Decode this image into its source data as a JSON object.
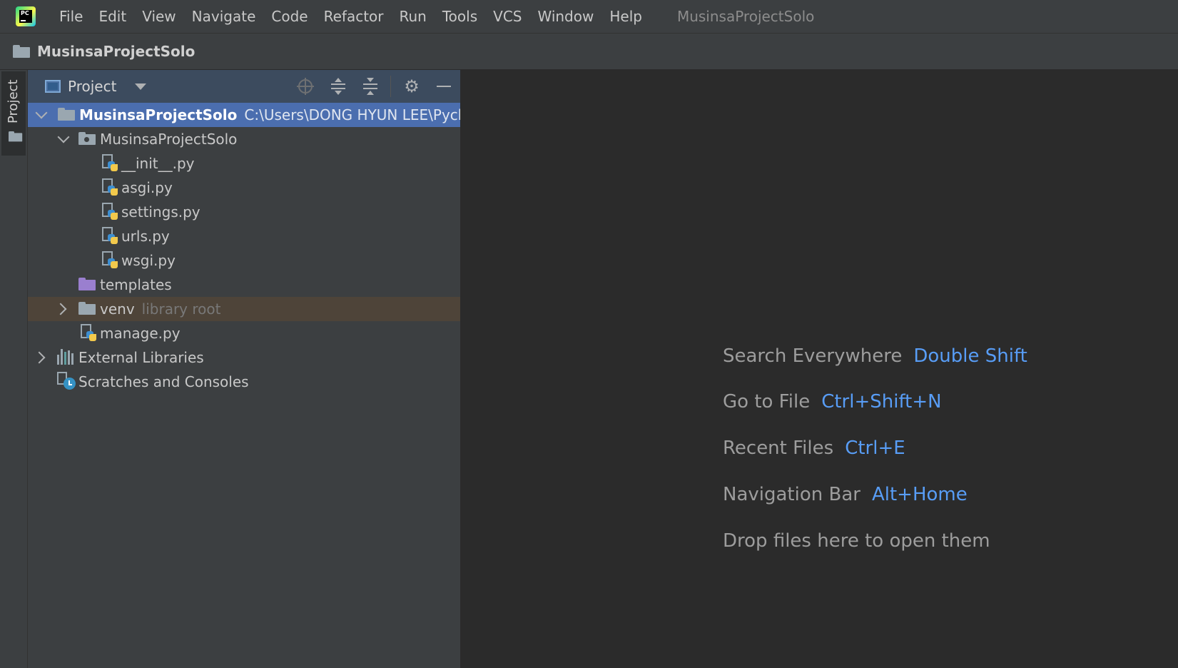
{
  "menubar": {
    "items": [
      "File",
      "Edit",
      "View",
      "Navigate",
      "Code",
      "Refactor",
      "Run",
      "Tools",
      "VCS",
      "Window",
      "Help"
    ],
    "window_title": "MusinsaProjectSolo",
    "logo_text": "PC"
  },
  "navbar": {
    "crumb": "MusinsaProjectSolo"
  },
  "stripe": {
    "project_tab": "Project"
  },
  "project_panel": {
    "title": "Project",
    "tree": {
      "root_name": "MusinsaProjectSolo",
      "root_path": "C:\\Users\\DONG HYUN LEE\\Pych",
      "package_name": "MusinsaProjectSolo",
      "files": [
        "__init__.py",
        "asgi.py",
        "settings.py",
        "urls.py",
        "wsgi.py"
      ],
      "templates": "templates",
      "venv": "venv",
      "venv_hint": "library root",
      "manage": "manage.py",
      "external_libraries": "External Libraries",
      "scratches": "Scratches and Consoles"
    }
  },
  "editor": {
    "hints": [
      {
        "text": "Search Everywhere",
        "key": "Double Shift"
      },
      {
        "text": "Go to File",
        "key": "Ctrl+Shift+N"
      },
      {
        "text": "Recent Files",
        "key": "Ctrl+E"
      },
      {
        "text": "Navigation Bar",
        "key": "Alt+Home"
      }
    ],
    "drop_text": "Drop files here to open them"
  },
  "colors": {
    "selection": "#4b6eaf",
    "excluded_row": "#4e4439",
    "shortcut_key": "#589df6",
    "hint_text": "#9d9d9d"
  }
}
